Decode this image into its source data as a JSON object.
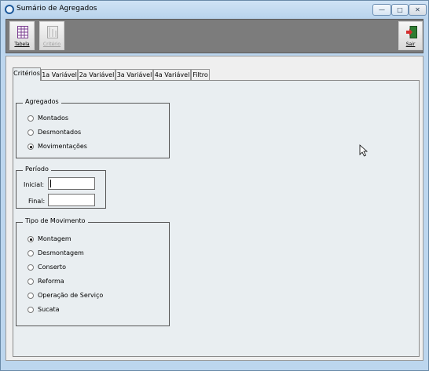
{
  "window": {
    "title": "Sumário de Agregados"
  },
  "titlebar_buttons": {
    "minimize": "—",
    "maximize": "□",
    "close": "✕"
  },
  "toolbar": {
    "tabela_label": "Tabela",
    "criterio_label": "Critério",
    "sair_label": "Sair"
  },
  "tabs": [
    {
      "label": "Critérios"
    },
    {
      "label": "1a Variável"
    },
    {
      "label": "2a Variável"
    },
    {
      "label": "3a Variável"
    },
    {
      "label": "4a Variável"
    },
    {
      "label": "Filtro"
    }
  ],
  "agregados": {
    "title": "Agregados",
    "options": [
      {
        "label": "Montados"
      },
      {
        "label": "Desmontados"
      },
      {
        "label": "Movimentações"
      }
    ],
    "selected": "Movimentações"
  },
  "periodo": {
    "title": "Período",
    "inicial_label": "Inicial:",
    "inicial_value": "",
    "final_label": "Final:",
    "final_value": ""
  },
  "tipo_movimento": {
    "title": "Tipo de Movimento",
    "options": [
      {
        "label": "Montagem"
      },
      {
        "label": "Desmontagem"
      },
      {
        "label": "Conserto"
      },
      {
        "label": "Reforma"
      },
      {
        "label": "Operação de Serviço"
      },
      {
        "label": "Sucata"
      }
    ],
    "selected": "Montagem"
  },
  "colors": {
    "titlebar": "#bcd6ee",
    "toolbar": "#7c7c7c",
    "panel": "#e9eef1"
  }
}
